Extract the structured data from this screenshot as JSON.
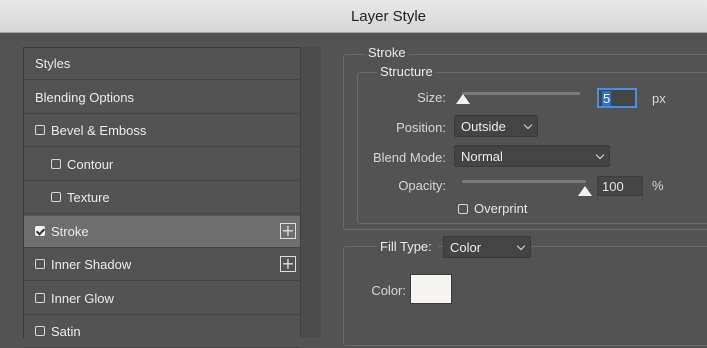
{
  "window": {
    "title": "Layer Style"
  },
  "styles_list": {
    "items": [
      {
        "label": "Styles",
        "checkbox": false,
        "checked": false,
        "indent": false,
        "selected": false,
        "plus": false
      },
      {
        "label": "Blending Options",
        "checkbox": false,
        "checked": false,
        "indent": false,
        "selected": false,
        "plus": false
      },
      {
        "label": "Bevel & Emboss",
        "checkbox": true,
        "checked": false,
        "indent": false,
        "selected": false,
        "plus": false
      },
      {
        "label": "Contour",
        "checkbox": true,
        "checked": false,
        "indent": true,
        "selected": false,
        "plus": false
      },
      {
        "label": "Texture",
        "checkbox": true,
        "checked": false,
        "indent": true,
        "selected": false,
        "plus": false
      },
      {
        "label": "Stroke",
        "checkbox": true,
        "checked": true,
        "indent": false,
        "selected": true,
        "plus": true
      },
      {
        "label": "Inner Shadow",
        "checkbox": true,
        "checked": false,
        "indent": false,
        "selected": false,
        "plus": true
      },
      {
        "label": "Inner Glow",
        "checkbox": true,
        "checked": false,
        "indent": false,
        "selected": false,
        "plus": false
      },
      {
        "label": "Satin",
        "checkbox": true,
        "checked": false,
        "indent": false,
        "selected": false,
        "plus": false
      }
    ]
  },
  "stroke": {
    "section_title": "Stroke",
    "structure_title": "Structure",
    "size_label": "Size:",
    "size_value": "5",
    "size_unit": "px",
    "position_label": "Position:",
    "position_value": "Outside",
    "blend_mode_label": "Blend Mode:",
    "blend_mode_value": "Normal",
    "opacity_label": "Opacity:",
    "opacity_value": "100",
    "opacity_unit": "%",
    "overprint_label": "Overprint",
    "overprint_checked": false,
    "fill_type_label": "Fill Type:",
    "fill_type_value": "Color",
    "color_label": "Color:",
    "color_value": "#f7f5f2"
  }
}
